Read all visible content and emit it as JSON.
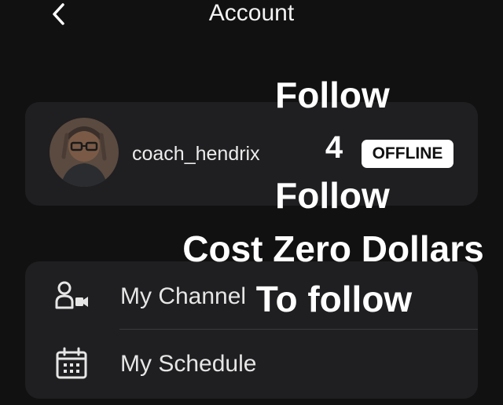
{
  "header": {
    "title": "Account",
    "back_icon": "chevron-left-icon"
  },
  "profile": {
    "username": "coach_hendrix",
    "status": "OFFLINE",
    "avatar_icon": "user-avatar"
  },
  "menu": [
    {
      "label": "My Channel",
      "icon": "channel-camera-icon"
    },
    {
      "label": "My Schedule",
      "icon": "calendar-icon"
    }
  ],
  "overlay_text": [
    "Follow",
    "4",
    "Follow",
    "Cost Zero Dollars",
    "To follow"
  ],
  "colors": {
    "background": "#121112",
    "card": "#1f1e20",
    "badge_bg": "#ffffff",
    "text": "#ffffff"
  }
}
